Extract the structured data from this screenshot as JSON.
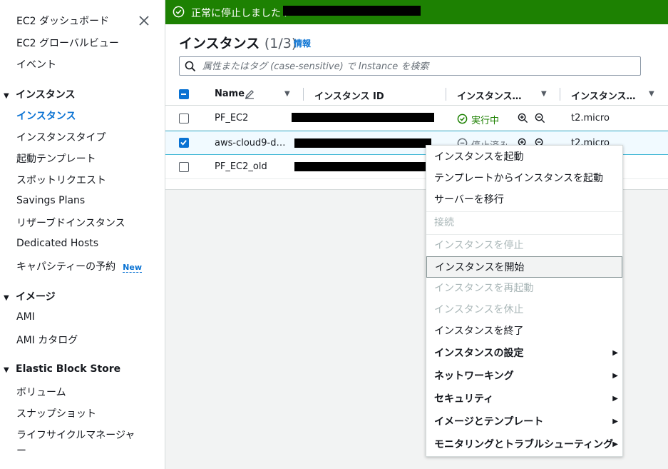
{
  "sidebar": {
    "top_items": [
      "EC2 ダッシュボード",
      "EC2 グローバルビュー",
      "イベント"
    ],
    "sections": [
      {
        "title": "インスタンス",
        "items": [
          "インスタンス",
          "インスタンスタイプ",
          "起動テンプレート",
          "スポットリクエスト",
          "Savings Plans",
          "リザーブドインスタンス",
          "Dedicated Hosts",
          "キャパシティーの予約"
        ]
      },
      {
        "title": "イメージ",
        "items": [
          "AMI",
          "AMI カタログ"
        ]
      },
      {
        "title": "Elastic Block Store",
        "items": [
          "ボリューム",
          "スナップショット",
          "ライフサイクルマネージャ",
          "ー"
        ]
      }
    ],
    "new_badge": "New"
  },
  "flash": {
    "message": "正常に停止しました i-"
  },
  "panel": {
    "title": "インスタンス",
    "count": "(1/3)",
    "info_link": "情報",
    "search_placeholder": "属性またはタグ (case-sensitive) で Instance を検索"
  },
  "table": {
    "columns": [
      "Name",
      "インスタンス ID",
      "インスタンス…",
      "インスタンス…"
    ],
    "rows": [
      {
        "name": "PF_EC2",
        "state": "実行中",
        "type": "t2.micro",
        "checked": false
      },
      {
        "name": "aws-cloud9-d…",
        "state": "停止済み",
        "type": "t2.micro",
        "checked": true
      },
      {
        "name": "PF_EC2_old",
        "state": "",
        "type": "",
        "checked": false
      }
    ]
  },
  "menu": {
    "items": [
      {
        "label": "インスタンスを起動",
        "disabled": false
      },
      {
        "label": "テンプレートからインスタンスを起動",
        "disabled": false
      },
      {
        "label": "サーバーを移行",
        "disabled": false
      },
      {
        "label": "接続",
        "disabled": true
      },
      {
        "label": "インスタンスを停止",
        "disabled": true
      },
      {
        "label": "インスタンスを開始",
        "disabled": false
      },
      {
        "label": "インスタンスを再起動",
        "disabled": true
      },
      {
        "label": "インスタンスを休止",
        "disabled": true
      },
      {
        "label": "インスタンスを終了",
        "disabled": false
      },
      {
        "label": "インスタンスの設定",
        "submenu": true
      },
      {
        "label": "ネットワーキング",
        "submenu": true
      },
      {
        "label": "セキュリティ",
        "submenu": true
      },
      {
        "label": "イメージとテンプレート",
        "submenu": true
      },
      {
        "label": "モニタリングとトラブルシューティング",
        "submenu": true
      }
    ]
  },
  "colors": {
    "success": "#1d8102",
    "link": "#0972d3",
    "disabled": "#aab7b8"
  }
}
